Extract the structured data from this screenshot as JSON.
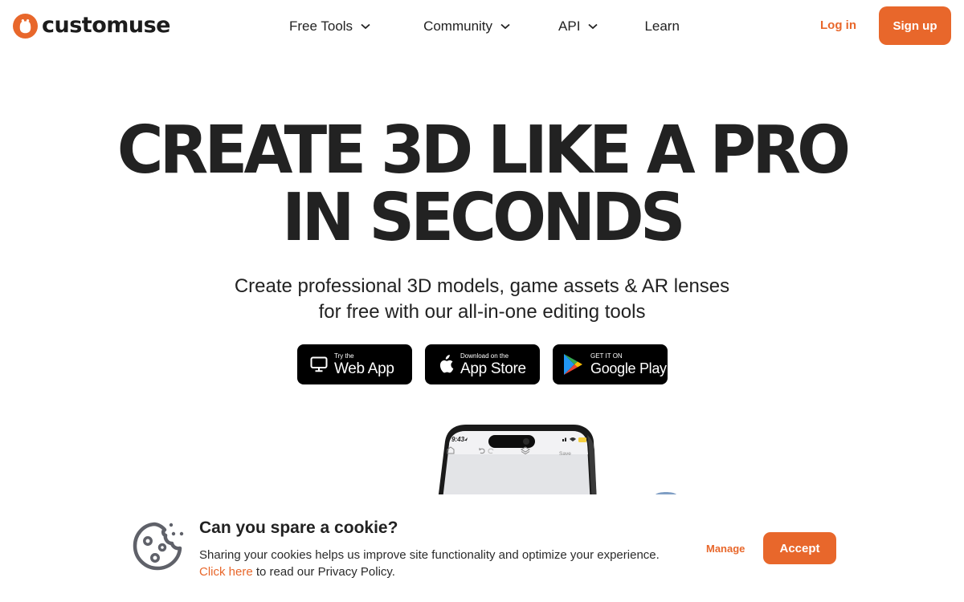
{
  "brand": {
    "name": "customuse",
    "accent_color": "#e8672b",
    "text_color": "#222222"
  },
  "nav": {
    "items": [
      {
        "label": "Free Tools",
        "has_dropdown": true
      },
      {
        "label": "Community",
        "has_dropdown": true
      },
      {
        "label": "API",
        "has_dropdown": true
      },
      {
        "label": "Learn",
        "has_dropdown": false
      }
    ],
    "login_label": "Log in",
    "signup_label": "Sign up"
  },
  "hero": {
    "title_line1": "CREATE 3D LIKE A PRO",
    "title_line2": "IN SECONDS",
    "subtitle_line1": "Create professional 3D models, game assets & AR lenses",
    "subtitle_line2": "for free with our all-in-one editing tools",
    "stores": [
      {
        "icon": "monitor-icon",
        "small": "Try the",
        "big": "Web App"
      },
      {
        "icon": "apple-icon",
        "small": "Download on the",
        "big": "App Store"
      },
      {
        "icon": "google-play-icon",
        "small": "GET IT ON",
        "big": "Google Play"
      }
    ]
  },
  "phone": {
    "time": "9:43",
    "save_label": "Save"
  },
  "cookie": {
    "title": "Can you spare a cookie?",
    "text": "Sharing your cookies helps us improve site functionality and optimize your experience.",
    "link_label": "Click here",
    "link_suffix": " to read our Privacy Policy.",
    "manage_label": "Manage",
    "accept_label": "Accept"
  }
}
